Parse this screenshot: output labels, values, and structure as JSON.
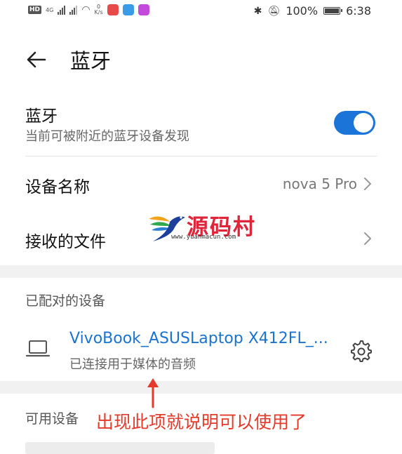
{
  "status_bar": {
    "hd_label": "HD",
    "net_label": "4G",
    "speed_value": "0",
    "speed_unit": "K/s",
    "battery_text": "100%",
    "battery_level": 1.0,
    "time": "6:38"
  },
  "header": {
    "title": "蓝牙",
    "back_icon": "arrow-left-icon"
  },
  "bluetooth": {
    "title": "蓝牙",
    "subtitle": "当前可被附近的蓝牙设备发现",
    "enabled": true,
    "accent_color": "#1b74d8"
  },
  "device_name_row": {
    "label": "设备名称",
    "value": "nova 5 Pro"
  },
  "received_files_row": {
    "label": "接收的文件"
  },
  "paired_section": {
    "label": "已配对的设备",
    "devices": [
      {
        "name": "VivoBook_ASUSLaptop X412FL_...",
        "status": "已连接用于媒体的音频",
        "icon": "laptop-icon",
        "settings_icon": "gear-icon"
      }
    ]
  },
  "available_section": {
    "label": "可用设备"
  },
  "watermark": {
    "text": "源码村",
    "url": "www.yuanmacun.com"
  },
  "annotation": {
    "text": "出现此项就说明可以使用了",
    "color": "#e53a2a"
  }
}
